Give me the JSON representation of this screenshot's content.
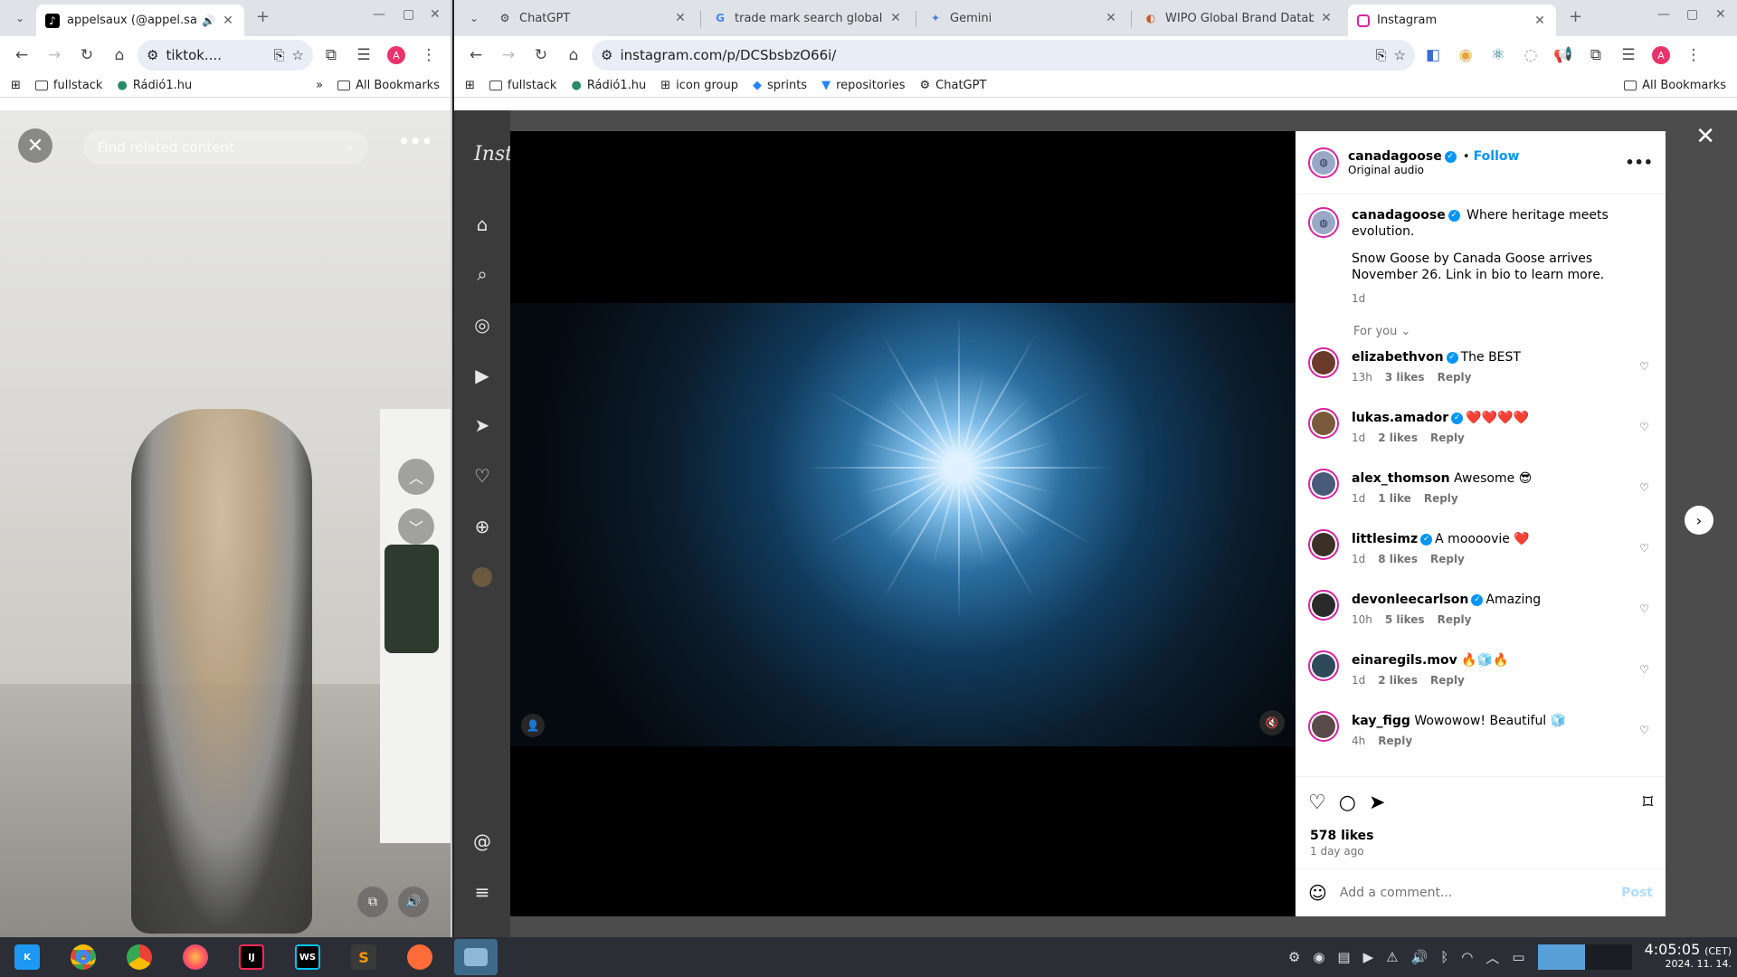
{
  "left_browser": {
    "tab": {
      "title": "appelsaux (@appel.saux",
      "close": "✕"
    },
    "new_tab": "+",
    "url": "tiktok....",
    "bookmarks": [
      {
        "label": "fullstack"
      },
      {
        "label": "Rádió1.hu"
      }
    ],
    "more_bookmarks": "»",
    "all_bookmarks": "All Bookmarks"
  },
  "tiktok": {
    "search_placeholder": "Find related content",
    "close": "✕",
    "more": "•••"
  },
  "right_browser": {
    "tabs": [
      {
        "title": "ChatGPT",
        "icon": "chatgpt-icon"
      },
      {
        "title": "trade mark search globally",
        "icon": "google-icon"
      },
      {
        "title": "Gemini",
        "icon": "gemini-icon"
      },
      {
        "title": "WIPO Global Brand Databa",
        "icon": "wipo-icon"
      },
      {
        "title": "Instagram",
        "icon": "instagram-icon"
      }
    ],
    "new_tab": "+",
    "url": "instagram.com/p/DCSbsbzO66i/",
    "bookmarks": [
      {
        "label": "fullstack"
      },
      {
        "label": "Rádió1.hu"
      },
      {
        "label": "icon group"
      },
      {
        "label": "sprints"
      },
      {
        "label": "repositories"
      },
      {
        "label": "ChatGPT"
      }
    ],
    "all_bookmarks": "All Bookmarks"
  },
  "instagram": {
    "logo": "Inst",
    "post": {
      "author": "canadagoose",
      "follow": "Follow",
      "audio": "Original audio",
      "more": "•••",
      "caption_line1": "Where heritage meets evolution.",
      "caption_line2": "Snow Goose by Canada Goose arrives November 26. Link in bio to learn more.",
      "caption_age": "1d",
      "for_you": "For you",
      "likes": "578 likes",
      "age": "1 day ago",
      "add_comment": "Add a comment...",
      "post_btn": "Post"
    },
    "comments": [
      {
        "user": "elizabethvon",
        "verified": true,
        "text": "The BEST",
        "age": "13h",
        "likes": "3 likes",
        "reply": "Reply",
        "color": "#6b3a2a"
      },
      {
        "user": "lukas.amador",
        "verified": true,
        "text": "❤️❤️❤️❤️",
        "age": "1d",
        "likes": "2 likes",
        "reply": "Reply",
        "color": "#7a5a3a"
      },
      {
        "user": "alex_thomson",
        "verified": false,
        "text": "Awesome 😎",
        "age": "1d",
        "likes": "1 like",
        "reply": "Reply",
        "color": "#4a5a7a"
      },
      {
        "user": "littlesimz",
        "verified": true,
        "text": "A moooovie ❤️",
        "age": "1d",
        "likes": "8 likes",
        "reply": "Reply",
        "color": "#3a3028"
      },
      {
        "user": "devonleecarlson",
        "verified": true,
        "text": "Amazing",
        "age": "10h",
        "likes": "5 likes",
        "reply": "Reply",
        "color": "#2a2a2a"
      },
      {
        "user": "einaregils.mov",
        "verified": false,
        "text": "🔥🧊🔥",
        "age": "1d",
        "likes": "2 likes",
        "reply": "Reply",
        "color": "#2e4a5a"
      },
      {
        "user": "kay_figg",
        "verified": false,
        "text": "Wowowow! Beautiful 🧊",
        "age": "4h",
        "likes": "",
        "reply": "Reply",
        "color": "#5a4a4a"
      }
    ]
  },
  "taskbar": {
    "time": "4:05:05",
    "tz": "(CET)",
    "date": "2024. 11. 14."
  },
  "colors": {
    "accent": "#0095f6",
    "ig_bg": "#4c4c4c",
    "taskbar": "#2b2f35"
  }
}
